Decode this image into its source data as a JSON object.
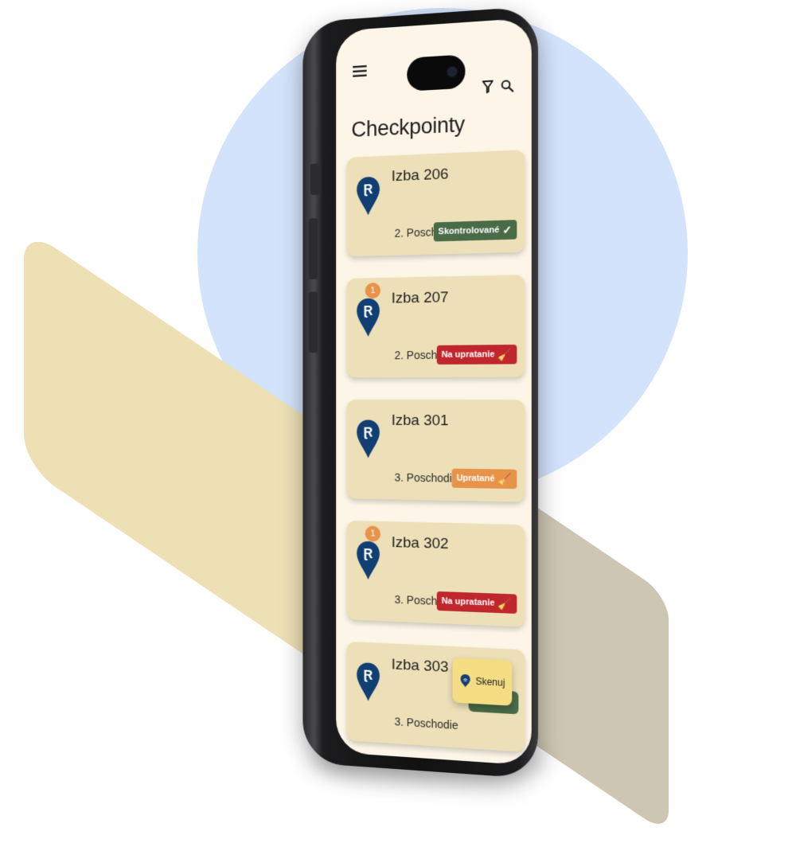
{
  "app": {
    "title": "Checkpointy",
    "menu_icon": "menu-icon",
    "filter_icon": "filter-icon",
    "search_icon": "search-icon"
  },
  "colors": {
    "background_circle": "#d3e3fb",
    "band_cream": "#ede0b5",
    "band_grey": "#cdc6b3",
    "card": "#ede0b8",
    "pin": "#113f73",
    "badge": "#e8934a",
    "status_checked": "#4a6b48",
    "status_to_clean": "#c0272d",
    "status_cleaned": "#e8934a",
    "fab": "#f5dd84"
  },
  "checkpoints": [
    {
      "room": "Izba 206",
      "floor": "2. Poschodie",
      "status": "Skontrolované",
      "status_icon": "check-icon",
      "status_type": "checked",
      "notifications": null
    },
    {
      "room": "Izba 207",
      "floor": "2. Poschodie",
      "status": "Na upratanie",
      "status_icon": "cleaning-needed-icon",
      "status_type": "to_clean",
      "notifications": "1"
    },
    {
      "room": "Izba 301",
      "floor": "3. Poschodie",
      "status": "Upratané",
      "status_icon": "broom-icon",
      "status_type": "cleaned",
      "notifications": null
    },
    {
      "room": "Izba 302",
      "floor": "3. Poschodie",
      "status": "Na upratanie",
      "status_icon": "cleaning-needed-icon",
      "status_type": "to_clean",
      "notifications": "1"
    },
    {
      "room": "Izba 303",
      "floor": "3. Poschodie",
      "status": "",
      "status_icon": "",
      "status_type": "checked",
      "notifications": null
    }
  ],
  "fab": {
    "label": "Skenuj",
    "icon": "nfc-pin-icon"
  }
}
